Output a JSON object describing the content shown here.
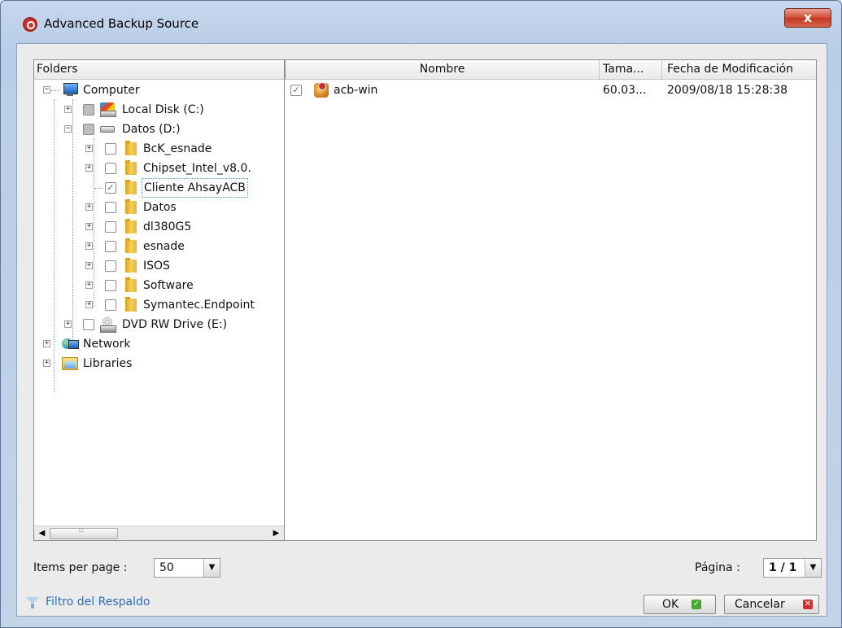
{
  "window": {
    "title": "Advanced Backup Source",
    "close_glyph": "x"
  },
  "tree": {
    "header": "Folders",
    "nodes": [
      {
        "label": "Computer"
      },
      {
        "label": "Local Disk (C:)"
      },
      {
        "label": "Datos (D:)"
      },
      {
        "label": "BcK_esnade"
      },
      {
        "label": "Chipset_Intel_v8.0."
      },
      {
        "label": "Cliente AhsayACB"
      },
      {
        "label": "Datos"
      },
      {
        "label": "dl380G5"
      },
      {
        "label": "esnade"
      },
      {
        "label": "ISOS"
      },
      {
        "label": "Software"
      },
      {
        "label": "Symantec.Endpoint"
      },
      {
        "label": "DVD RW Drive (E:)"
      },
      {
        "label": "Network"
      },
      {
        "label": "Libraries"
      }
    ]
  },
  "list": {
    "columns": {
      "name": "Nombre",
      "size": "Tama...",
      "modified": "Fecha de Modificación"
    },
    "rows": [
      {
        "name": "acb-win",
        "size": "60.03...",
        "modified": "2009/08/18 15:28:38",
        "checked": true
      }
    ]
  },
  "footer": {
    "items_per_page_label": "Items per page :",
    "items_per_page_value": "50",
    "page_label": "Página :",
    "page_value": "1 / 1",
    "filter_link": "Filtro del Respaldo",
    "ok_label": "OK",
    "cancel_label": "Cancelar"
  }
}
